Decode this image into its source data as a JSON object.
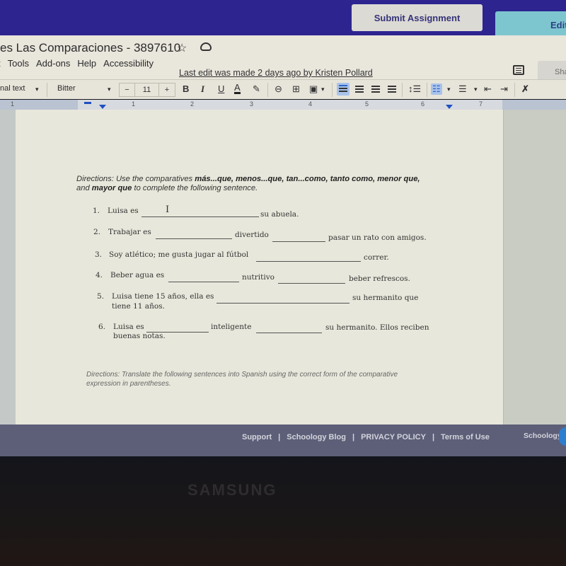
{
  "top_bar": {
    "submit_button": "Submit Assignment",
    "edit_button": "Edit"
  },
  "docs": {
    "title": "es Las Comparaciones - 3897610",
    "menu": [
      "t",
      "Tools",
      "Add-ons",
      "Help",
      "Accessibility"
    ],
    "last_edit": "Last edit was made 2 days ago by Kristen Pollard",
    "share_label": "Sha"
  },
  "toolbar": {
    "style": "nal text",
    "font": "Bitter",
    "size_minus": "−",
    "font_size": "11",
    "size_plus": "+",
    "bold": "B",
    "italic": "I",
    "underline": "U",
    "text_color": "A",
    "highlight": "✎",
    "link": "⊖",
    "comment": "⊞",
    "image": "▣",
    "line_spacing": "↕☰",
    "numbered_list": "☷",
    "bulleted_list": "☰",
    "decrease_indent": "⇤",
    "increase_indent": "⇥",
    "clear_format": "✗",
    "dropdown": "▾"
  },
  "ruler": {
    "numbers": [
      "1",
      "1",
      "2",
      "3",
      "4",
      "5",
      "6",
      "7"
    ]
  },
  "document": {
    "directions_1": {
      "prefix": "Directions: Use the comparatives ",
      "bold_1": "más...que, menos...que, tan...como, tanto como, menor que,",
      "middle": " and ",
      "bold_2": "mayor que",
      "suffix": " to complete the following sentence."
    },
    "questions": [
      {
        "num": "1.",
        "parts": [
          "Luisa es",
          "su abuela."
        ]
      },
      {
        "num": "2.",
        "parts": [
          "Trabajar es",
          "divertido",
          "pasar un rato con amigos."
        ]
      },
      {
        "num": "3.",
        "parts": [
          "Soy atlético; me gusta jugar al fútbol",
          "correr."
        ]
      },
      {
        "num": "4.",
        "parts": [
          "Beber agua es",
          "nutritivo",
          "beber refrescos."
        ]
      },
      {
        "num": "5.",
        "parts": [
          "Luisa tiene 15 años, ella es",
          "su hermanito que",
          "tiene 11 años."
        ]
      },
      {
        "num": "6.",
        "parts": [
          "Luisa es",
          "inteligente",
          "su hermanito. Ellos reciben",
          "buenas notas."
        ]
      }
    ],
    "directions_2": "Directions: Translate the following sentences into Spanish using the correct form of the comparative expression in parentheses."
  },
  "footer": {
    "links": [
      "Support",
      "|",
      "Schoology Blog",
      "|",
      "PRIVACY POLICY",
      "|",
      "Terms of Use"
    ],
    "brand": "Schoology"
  },
  "device": {
    "brand": "SAMSUNG"
  },
  "colors": {
    "top_bar": "#2d2490",
    "submit_bg": "#dcdad4",
    "edit_bg": "#7ec6cf",
    "footer_bg": "#5d5f78",
    "accent_blue": "#1f4fc1"
  }
}
